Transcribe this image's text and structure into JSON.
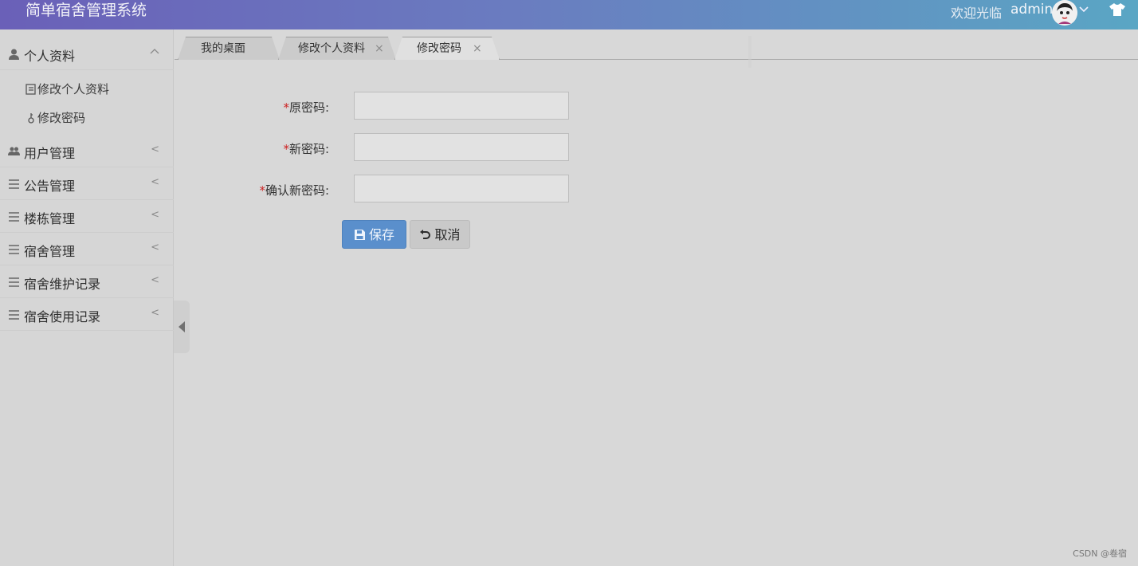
{
  "header": {
    "app_title": "简单宿舍管理系统",
    "welcome_text": "欢迎光临",
    "username": "admin",
    "dropdown_icon": "chevron-down-icon",
    "theme_icon": "shirt-icon"
  },
  "sidebar": {
    "groups": [
      {
        "label": "个人资料",
        "icon": "user-icon",
        "arrow": "^",
        "expanded": true,
        "items": [
          {
            "label": "修改个人资料",
            "icon": "edit-icon"
          },
          {
            "label": "修改密码",
            "icon": "key-icon"
          }
        ]
      },
      {
        "label": "用户管理",
        "icon": "users-icon",
        "arrow": "<"
      },
      {
        "label": "公告管理",
        "icon": "list-icon",
        "arrow": "<"
      },
      {
        "label": "楼栋管理",
        "icon": "list-icon",
        "arrow": "<"
      },
      {
        "label": "宿舍管理",
        "icon": "list-icon",
        "arrow": "<"
      },
      {
        "label": "宿舍维护记录",
        "icon": "list-icon",
        "arrow": "<"
      },
      {
        "label": "宿舍使用记录",
        "icon": "list-icon",
        "arrow": "<"
      }
    ]
  },
  "tabs": [
    {
      "label": "我的桌面",
      "closable": false,
      "active": false
    },
    {
      "label": "修改个人资料",
      "close": "×",
      "active": false
    },
    {
      "label": "修改密码",
      "close": "×",
      "active": true
    }
  ],
  "form": {
    "required_mark": "*",
    "fields": [
      {
        "label": "原密码:",
        "value": ""
      },
      {
        "label": "新密码:",
        "value": ""
      },
      {
        "label": "确认新密码:",
        "value": ""
      }
    ],
    "save_label": "保存",
    "cancel_label": "取消"
  },
  "watermark": "CSDN @卷宿",
  "colors": {
    "header_start": "#6a60b8",
    "header_end": "#5aa6c4",
    "save_button": "#5a8fcc",
    "required": "#cc2222"
  }
}
